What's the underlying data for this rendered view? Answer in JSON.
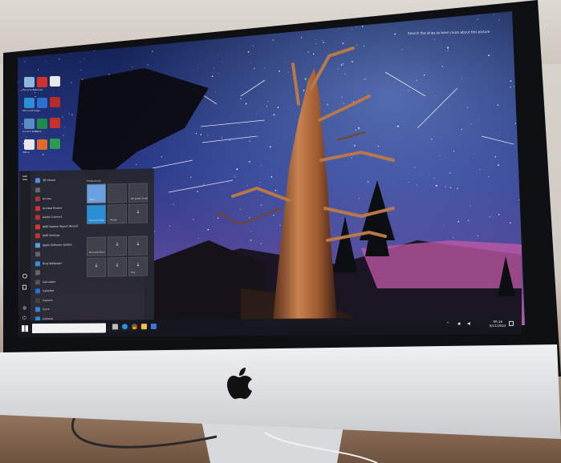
{
  "photo": {
    "subject": "iMac",
    "colors": {
      "wall": "#d6d0c9",
      "bezel": "#0f1013",
      "chin": "#e7e8ea",
      "taskbar": "#16181f",
      "start_menu": "#26282f",
      "sky_top": "#0d1a44",
      "sky_horizon": "#b25aa6"
    }
  },
  "desktop": {
    "search_hint": "Search the skies to learn more about this picture",
    "icons": [
      {
        "name": "recycle-bin",
        "label": "Recycle Bin",
        "color": "#8fb7d9"
      },
      {
        "name": "acrobat",
        "label": "Adobe",
        "color": "#d3312a"
      },
      {
        "name": "file",
        "label": "",
        "color": "#e8e8e8"
      },
      {
        "name": "edge",
        "label": "Microsoft Edge",
        "color": "#2a8fd6"
      },
      {
        "name": "store",
        "label": "",
        "color": "#2f6fd0"
      },
      {
        "name": "pdf",
        "label": "",
        "color": "#b52b2b"
      },
      {
        "name": "control-panel",
        "label": "Control Panel",
        "color": "#5a8bc7"
      },
      {
        "name": "excel",
        "label": "Excel",
        "color": "#1f8a4b"
      },
      {
        "name": "pdf-reader",
        "label": "",
        "color": "#c9302c"
      },
      {
        "name": "office",
        "label": "Office",
        "color": "#e8e8e8"
      },
      {
        "name": "paint",
        "label": "",
        "color": "#e06a2a"
      },
      {
        "name": "excel2",
        "label": "",
        "color": "#2c9b52"
      }
    ]
  },
  "start_menu": {
    "apps": [
      {
        "label": "3D Viewer",
        "color": "#5a8bd6"
      },
      {
        "label": "",
        "color": "#666"
      },
      {
        "label": "Access",
        "color": "#a4373a"
      },
      {
        "label": "Acrobat Reader",
        "color": "#d3312a"
      },
      {
        "label": "Adobe Connect",
        "color": "#c92b2b"
      },
      {
        "label": "AMD Radeon Report Wizard",
        "color": "#d8372b"
      },
      {
        "label": "AMD Settings",
        "color": "#c8302a"
      },
      {
        "label": "Apple Software Update",
        "color": "#5aa1e0"
      },
      {
        "label": "",
        "color": "#666"
      },
      {
        "label": "Bing Wallpaper",
        "color": "#3a8fd6"
      },
      {
        "label": "",
        "color": "#666"
      },
      {
        "label": "Calculator",
        "color": "#555"
      },
      {
        "label": "Calendar",
        "color": "#2b6fd1"
      },
      {
        "label": "Camera",
        "color": "#444"
      },
      {
        "label": "Clock",
        "color": "#3b7fd6"
      },
      {
        "label": "Cortana",
        "color": "#2f8ad8"
      }
    ],
    "groups": [
      "Productivity",
      "Explore"
    ],
    "tiles": [
      {
        "label": "Office",
        "glyph": "",
        "color": "#6aa0e0"
      },
      {
        "label": "",
        "glyph": "",
        "color": "#3e404a"
      },
      {
        "label": "We speak Gmail",
        "glyph": "",
        "color": "#3e404a"
      },
      {
        "label": "Microsoft Edge",
        "glyph": "",
        "color": "#2a8fd6"
      },
      {
        "label": "Photos",
        "glyph": "",
        "color": "#3e404a"
      },
      {
        "label": "",
        "glyph": "↓",
        "color": "#3e404a"
      },
      {
        "label": "Microsoft Store",
        "glyph": "",
        "color": "#3e404a"
      },
      {
        "label": "",
        "glyph": "↓",
        "color": "#3e404a"
      },
      {
        "label": "",
        "glyph": "↓",
        "color": "#3e404a"
      },
      {
        "label": "",
        "glyph": "↓",
        "color": "#3e404a"
      },
      {
        "label": "",
        "glyph": "↓",
        "color": "#3e404a"
      },
      {
        "label": "Play",
        "glyph": "↓",
        "color": "#3e404a"
      }
    ]
  },
  "taskbar": {
    "time": "00:16",
    "date": "8/11/2024"
  }
}
